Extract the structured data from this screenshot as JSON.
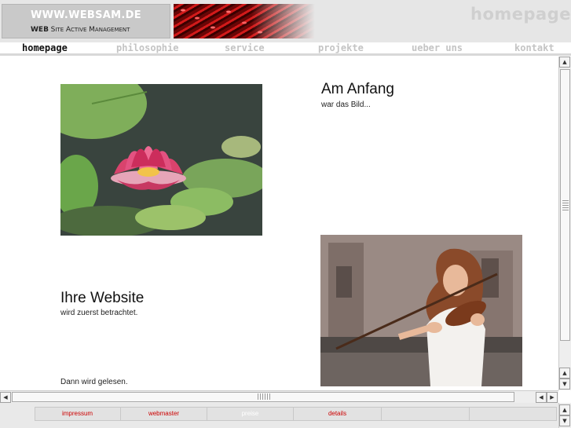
{
  "header": {
    "logo_title": "WWW.WEBSAM.DE",
    "logo_subtitle_parts": [
      "WEB",
      "SITE",
      "ACTIVE",
      "MANAGEMENT"
    ],
    "page_heading": "homepage"
  },
  "nav": {
    "items": [
      {
        "label": "homepage",
        "active": true
      },
      {
        "label": "philosophie",
        "active": false
      },
      {
        "label": "service",
        "active": false
      },
      {
        "label": "projekte",
        "active": false
      },
      {
        "label": "ueber uns",
        "active": false
      },
      {
        "label": "kontakt",
        "active": false
      }
    ]
  },
  "content": {
    "block1_title": "Am Anfang",
    "block1_text": "war das Bild...",
    "block2_title": "Ihre Website",
    "block2_text": "wird zuerst betrachtet.",
    "block3_text": "Dann wird gelesen."
  },
  "footer": {
    "items": [
      {
        "label": "impressum",
        "color": "#cc0000"
      },
      {
        "label": "webmaster",
        "color": "#cc0000"
      },
      {
        "label": "preise",
        "color": "#ffffff"
      },
      {
        "label": "details",
        "color": "#cc0000"
      },
      {
        "label": "",
        "color": "#cc0000"
      },
      {
        "label": "",
        "color": "#cc0000"
      }
    ]
  },
  "colors": {
    "accent": "#cc0000",
    "nav_inactive": "#c4c4c4",
    "header_bg": "#e6e6e6"
  },
  "icons": [
    "arrow-up-icon",
    "arrow-down-icon",
    "arrow-left-icon",
    "arrow-right-icon",
    "scroll-grip-icon"
  ]
}
